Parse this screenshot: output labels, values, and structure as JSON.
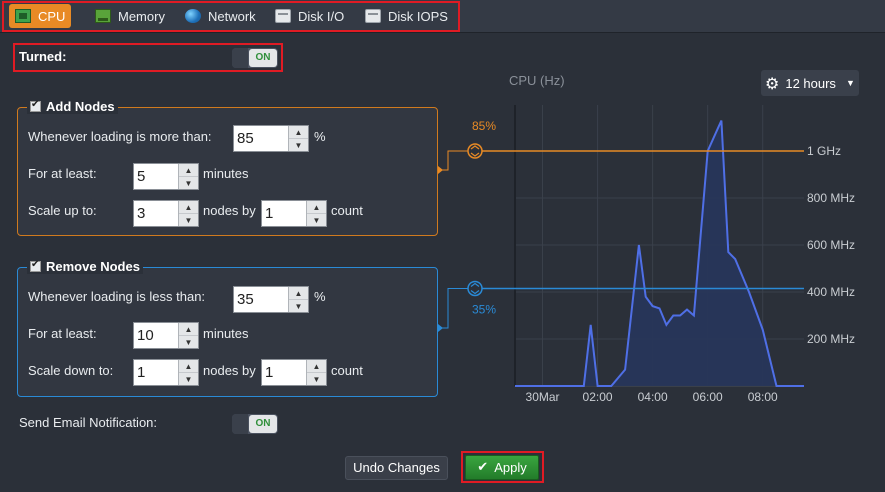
{
  "tabs": [
    {
      "label": "CPU",
      "icon": "cpu-icon",
      "active": true
    },
    {
      "label": "Memory",
      "icon": "memory-icon"
    },
    {
      "label": "Network",
      "icon": "network-icon"
    },
    {
      "label": "Disk I/O",
      "icon": "disk-icon"
    },
    {
      "label": "Disk IOPS",
      "icon": "disk-icon"
    }
  ],
  "turned": {
    "label": "Turned:",
    "state": "ON"
  },
  "add_nodes": {
    "title": "Add Nodes",
    "checked": true,
    "loading_label": "Whenever loading is more than:",
    "loading_value": "85",
    "loading_unit": "%",
    "at_least_label": "For at least:",
    "at_least_value": "5",
    "at_least_unit": "minutes",
    "scale_label": "Scale up to:",
    "scale_value": "3",
    "nodes_by_label": "nodes by",
    "count_value": "1",
    "count_label": "count"
  },
  "remove_nodes": {
    "title": "Remove Nodes",
    "checked": true,
    "loading_label": "Whenever loading is less than:",
    "loading_value": "35",
    "loading_unit": "%",
    "at_least_label": "For at least:",
    "at_least_value": "10",
    "at_least_unit": "minutes",
    "scale_label": "Scale down to:",
    "scale_value": "1",
    "nodes_by_label": "nodes by",
    "count_value": "1",
    "count_label": "count"
  },
  "email": {
    "label": "Send Email Notification:",
    "state": "ON"
  },
  "buttons": {
    "undo": "Undo Changes",
    "apply": "Apply"
  },
  "range": {
    "label": "12 hours"
  },
  "colors": {
    "accent_orange": "#e88a25",
    "accent_blue": "#2a8ad6",
    "apply_green": "#2e9535",
    "highlight_red": "#e01b24",
    "series": "#4f6fe6"
  },
  "chart_data": {
    "type": "area",
    "title": "CPU (Hz)",
    "x_ticks": [
      "30Mar",
      "02:00",
      "04:00",
      "06:00",
      "08:00"
    ],
    "y_ticks": [
      "1 GHz",
      "800 MHz",
      "600 MHz",
      "400 MHz",
      "200 MHz"
    ],
    "y_tick_values": [
      1000,
      800,
      600,
      400,
      200
    ],
    "ylim": [
      0,
      1000
    ],
    "thresholds": [
      {
        "label": "85%",
        "value": 1000,
        "color": "#e88a25"
      },
      {
        "label": "35%",
        "value": 415,
        "color": "#2a8ad6"
      }
    ],
    "x": [
      "23:00",
      "23:30",
      "00:00",
      "00:30",
      "01:00",
      "01:30",
      "01:45",
      "02:00",
      "02:15",
      "02:30",
      "03:00",
      "03:30",
      "03:45",
      "04:00",
      "04:15",
      "04:30",
      "04:45",
      "05:00",
      "05:15",
      "05:30",
      "06:00",
      "06:30",
      "06:45",
      "07:00",
      "07:30",
      "08:00",
      "08:30",
      "09:00",
      "09:30"
    ],
    "series": [
      {
        "values": [
          0,
          0,
          0,
          0,
          0,
          0,
          260,
          0,
          0,
          0,
          70,
          600,
          380,
          340,
          330,
          260,
          300,
          300,
          325,
          300,
          1000,
          1130,
          570,
          540,
          400,
          240,
          0,
          0,
          0
        ]
      }
    ]
  }
}
